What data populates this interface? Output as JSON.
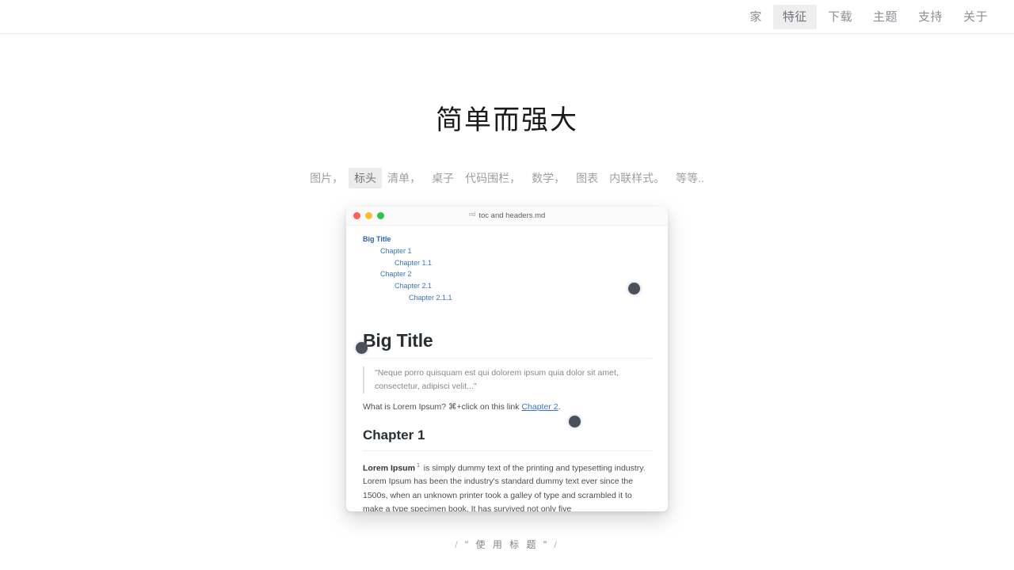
{
  "nav": {
    "items": [
      {
        "label": "家",
        "active": false
      },
      {
        "label": "特征",
        "active": true
      },
      {
        "label": "下载",
        "active": false
      },
      {
        "label": "主题",
        "active": false
      },
      {
        "label": "支持",
        "active": false
      },
      {
        "label": "关于",
        "active": false
      }
    ]
  },
  "hero": {
    "title": "简单而强大"
  },
  "features": {
    "items": [
      {
        "label": "图片，",
        "active": false
      },
      {
        "label": "标头",
        "active": true
      },
      {
        "label": "清单，",
        "active": false
      },
      {
        "label": "桌子",
        "active": false
      },
      {
        "label": "代码围栏，",
        "active": false
      },
      {
        "label": "数学，",
        "active": false
      },
      {
        "label": "图表",
        "active": false
      },
      {
        "label": "内联样式。",
        "active": false
      },
      {
        "label": "等等..",
        "active": false
      }
    ]
  },
  "mockup": {
    "window_title": "toc and headers.md",
    "filetype_badge": "md",
    "traffic_lights": [
      "close-red",
      "minimize-yellow",
      "zoom-green"
    ],
    "toc": [
      {
        "label": "Big Title",
        "level": 0
      },
      {
        "label": "Chapter 1",
        "level": 1
      },
      {
        "label": "Chapter 1.1",
        "level": 2
      },
      {
        "label": "Chapter 2",
        "level": 1
      },
      {
        "label": "Chapter 2.1",
        "level": 2
      },
      {
        "label": "Chapter 2.1.1",
        "level": 3
      }
    ],
    "h1": "Big Title",
    "quote": "\"Neque porro quisquam est qui dolorem ipsum quia dolor sit amet, consectetur, adipisci velit...\"",
    "link_para_prefix": "What is Lorem Ipsum? ⌘+click on this link ",
    "link_label": "Chapter 2",
    "link_para_suffix": ".",
    "h2": "Chapter 1",
    "body_bold": "Lorem Ipsum",
    "body_sup": "1",
    "body_text": " is simply dummy text of the printing and typesetting industry. Lorem Ipsum has been the industry's standard dummy text ever since the 1500s, when an unknown printer took a galley of type and scrambled it to make a type specimen book. It has survived not only five"
  },
  "footer": {
    "left_slash": "/",
    "text": "\" 使 用 标 题 \"",
    "right_slash": "/"
  },
  "colors": {
    "accent_link": "#3b73c4",
    "nav_text": "#8a8f94",
    "nav_active_bg": "#eeeeee",
    "pill_active_bg": "#ececec",
    "cursor_dot": "#4a515a",
    "light_red": "#ff5f57",
    "light_yellow": "#febc2e",
    "light_green": "#28c840"
  }
}
